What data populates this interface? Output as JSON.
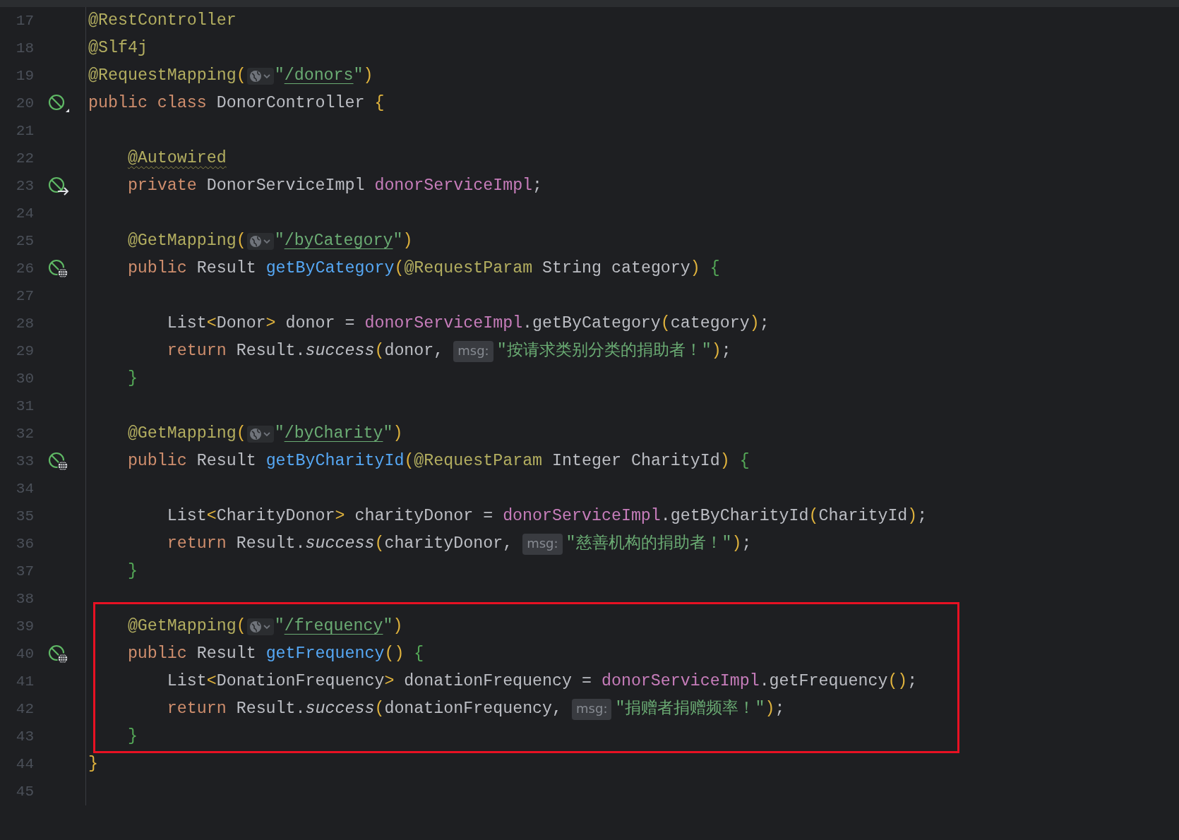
{
  "editor": {
    "lines": [
      {
        "number": "17",
        "highlighted": false,
        "tokens": [
          {
            "kind": "ann",
            "text": "@RestController"
          }
        ]
      },
      {
        "number": "18",
        "highlighted": false,
        "tokens": [
          {
            "kind": "ann",
            "text": "@Slf4j"
          }
        ]
      },
      {
        "number": "19",
        "highlighted": false,
        "tokens": [
          {
            "kind": "ann",
            "text": "@RequestMapping"
          },
          {
            "kind": "paren",
            "text": "("
          },
          {
            "kind": "globe"
          },
          {
            "kind": "str",
            "text": "\""
          },
          {
            "kind": "url",
            "text": "/donors"
          },
          {
            "kind": "str",
            "text": "\""
          },
          {
            "kind": "paren",
            "text": ")"
          }
        ]
      },
      {
        "number": "20",
        "highlighted": false,
        "gutter_icon": {
          "kind": "bean"
        },
        "tokens": [
          {
            "kind": "kw",
            "text": "public class "
          },
          {
            "kind": "plain",
            "text": "DonorController "
          },
          {
            "kind": "paren",
            "text": "{"
          }
        ],
        "children": [
          {
            "number": "21",
            "highlighted": false
          },
          {
            "number": "22",
            "highlighted": false,
            "tokens": [
              {
                "kind": "warn",
                "text": "@Autowired"
              }
            ]
          },
          {
            "number": "23",
            "highlighted": false,
            "gutter_icon": {
              "kind": "autowired"
            },
            "tokens": [
              {
                "kind": "kw",
                "text": "private "
              },
              {
                "kind": "plain",
                "text": "DonorServiceImpl "
              },
              {
                "kind": "field",
                "text": "donorServiceImpl"
              },
              {
                "kind": "plain",
                "text": ";"
              }
            ]
          },
          {
            "number": "24",
            "highlighted": false
          },
          {
            "number": "25",
            "highlighted": false,
            "tokens": [
              {
                "kind": "ann",
                "text": "@GetMapping"
              },
              {
                "kind": "paren",
                "text": "("
              },
              {
                "kind": "globe"
              },
              {
                "kind": "str",
                "text": "\""
              },
              {
                "kind": "url",
                "text": "/byCategory"
              },
              {
                "kind": "str",
                "text": "\""
              },
              {
                "kind": "paren",
                "text": ")"
              }
            ]
          },
          {
            "number": "26",
            "highlighted": false,
            "gutter_icon": {
              "kind": "endpoint"
            },
            "tokens": [
              {
                "kind": "kw",
                "text": "public "
              },
              {
                "kind": "plain",
                "text": "Result "
              },
              {
                "kind": "decl",
                "text": "getByCategory"
              },
              {
                "kind": "paren",
                "text": "("
              },
              {
                "kind": "ann",
                "text": "@RequestParam"
              },
              {
                "kind": "plain",
                "text": " String category"
              },
              {
                "kind": "paren",
                "text": ")"
              },
              {
                "kind": "brace",
                "text": " {"
              }
            ],
            "children": [
              {
                "number": "27",
                "highlighted": false
              },
              {
                "number": "28",
                "highlighted": false,
                "tokens": [
                  {
                    "kind": "plain",
                    "text": "List"
                  },
                  {
                    "kind": "paren",
                    "text": "<"
                  },
                  {
                    "kind": "plain",
                    "text": "Donor"
                  },
                  {
                    "kind": "paren",
                    "text": ">"
                  },
                  {
                    "kind": "plain",
                    "text": " donor = "
                  },
                  {
                    "kind": "field",
                    "text": "donorServiceImpl"
                  },
                  {
                    "kind": "plain",
                    "text": ".getByCategory"
                  },
                  {
                    "kind": "paren",
                    "text": "("
                  },
                  {
                    "kind": "plain",
                    "text": "category"
                  },
                  {
                    "kind": "paren",
                    "text": ")"
                  },
                  {
                    "kind": "plain",
                    "text": ";"
                  }
                ]
              },
              {
                "number": "29",
                "highlighted": false,
                "tokens": [
                  {
                    "kind": "kw",
                    "text": "return "
                  },
                  {
                    "kind": "plain",
                    "text": "Result."
                  },
                  {
                    "kind": "italic",
                    "text": "success"
                  },
                  {
                    "kind": "paren",
                    "text": "("
                  },
                  {
                    "kind": "plain",
                    "text": "donor, "
                  },
                  {
                    "kind": "hint",
                    "text": "msg:"
                  },
                  {
                    "kind": "str",
                    "text": "\"按请求类别分类的捐助者！\""
                  },
                  {
                    "kind": "paren",
                    "text": ")"
                  },
                  {
                    "kind": "plain",
                    "text": ";"
                  }
                ]
              }
            ]
          },
          {
            "number": "30",
            "highlighted": false,
            "tokens": [
              {
                "kind": "brace",
                "text": "}"
              }
            ]
          },
          {
            "number": "31",
            "highlighted": false
          },
          {
            "number": "32",
            "highlighted": false,
            "tokens": [
              {
                "kind": "ann",
                "text": "@GetMapping"
              },
              {
                "kind": "paren",
                "text": "("
              },
              {
                "kind": "globe"
              },
              {
                "kind": "str",
                "text": "\""
              },
              {
                "kind": "url",
                "text": "/byCharity"
              },
              {
                "kind": "str",
                "text": "\""
              },
              {
                "kind": "paren",
                "text": ")"
              }
            ]
          },
          {
            "number": "33",
            "highlighted": false,
            "gutter_icon": {
              "kind": "endpoint"
            },
            "tokens": [
              {
                "kind": "kw",
                "text": "public "
              },
              {
                "kind": "plain",
                "text": "Result "
              },
              {
                "kind": "decl",
                "text": "getByCharityId"
              },
              {
                "kind": "paren",
                "text": "("
              },
              {
                "kind": "ann",
                "text": "@RequestParam"
              },
              {
                "kind": "plain",
                "text": " Integer CharityId"
              },
              {
                "kind": "paren",
                "text": ")"
              },
              {
                "kind": "brace",
                "text": " {"
              }
            ],
            "children": [
              {
                "number": "34",
                "highlighted": false
              },
              {
                "number": "35",
                "highlighted": false,
                "tokens": [
                  {
                    "kind": "plain",
                    "text": "List"
                  },
                  {
                    "kind": "paren",
                    "text": "<"
                  },
                  {
                    "kind": "plain",
                    "text": "CharityDonor"
                  },
                  {
                    "kind": "paren",
                    "text": ">"
                  },
                  {
                    "kind": "plain",
                    "text": " charityDonor = "
                  },
                  {
                    "kind": "field",
                    "text": "donorServiceImpl"
                  },
                  {
                    "kind": "plain",
                    "text": ".getByCharityId"
                  },
                  {
                    "kind": "paren",
                    "text": "("
                  },
                  {
                    "kind": "plain",
                    "text": "CharityId"
                  },
                  {
                    "kind": "paren",
                    "text": ")"
                  },
                  {
                    "kind": "plain",
                    "text": ";"
                  }
                ]
              },
              {
                "number": "36",
                "highlighted": false,
                "tokens": [
                  {
                    "kind": "kw",
                    "text": "return "
                  },
                  {
                    "kind": "plain",
                    "text": "Result."
                  },
                  {
                    "kind": "italic",
                    "text": "success"
                  },
                  {
                    "kind": "paren",
                    "text": "("
                  },
                  {
                    "kind": "plain",
                    "text": "charityDonor, "
                  },
                  {
                    "kind": "hint",
                    "text": "msg:"
                  },
                  {
                    "kind": "str",
                    "text": "\"慈善机构的捐助者！\""
                  },
                  {
                    "kind": "paren",
                    "text": ")"
                  },
                  {
                    "kind": "plain",
                    "text": ";"
                  }
                ]
              }
            ]
          },
          {
            "number": "37",
            "highlighted": false,
            "tokens": [
              {
                "kind": "brace",
                "text": "}"
              }
            ]
          },
          {
            "number": "38",
            "highlighted": false
          },
          {
            "number": "39",
            "highlighted": true,
            "tokens": [
              {
                "kind": "ann",
                "text": "@GetMapping"
              },
              {
                "kind": "paren",
                "text": "("
              },
              {
                "kind": "globe"
              },
              {
                "kind": "str",
                "text": "\""
              },
              {
                "kind": "url",
                "text": "/frequency"
              },
              {
                "kind": "str",
                "text": "\""
              },
              {
                "kind": "paren",
                "text": ")"
              }
            ]
          },
          {
            "number": "40",
            "highlighted": true,
            "gutter_icon": {
              "kind": "endpoint"
            },
            "tokens": [
              {
                "kind": "kw",
                "text": "public "
              },
              {
                "kind": "plain",
                "text": "Result "
              },
              {
                "kind": "decl",
                "text": "getFrequency"
              },
              {
                "kind": "paren",
                "text": "()"
              },
              {
                "kind": "brace",
                "text": " {"
              }
            ],
            "children": [
              {
                "number": "41",
                "highlighted": true,
                "tokens": [
                  {
                    "kind": "plain",
                    "text": "List"
                  },
                  {
                    "kind": "paren",
                    "text": "<"
                  },
                  {
                    "kind": "plain",
                    "text": "DonationFrequency"
                  },
                  {
                    "kind": "paren",
                    "text": ">"
                  },
                  {
                    "kind": "plain",
                    "text": " donationFrequency = "
                  },
                  {
                    "kind": "field",
                    "text": "donorServiceImpl"
                  },
                  {
                    "kind": "plain",
                    "text": ".getFrequency"
                  },
                  {
                    "kind": "paren",
                    "text": "()"
                  },
                  {
                    "kind": "plain",
                    "text": ";"
                  }
                ]
              },
              {
                "number": "42",
                "highlighted": true,
                "tokens": [
                  {
                    "kind": "kw",
                    "text": "return "
                  },
                  {
                    "kind": "plain",
                    "text": "Result."
                  },
                  {
                    "kind": "italic",
                    "text": "success"
                  },
                  {
                    "kind": "paren",
                    "text": "("
                  },
                  {
                    "kind": "plain",
                    "text": "donationFrequency, "
                  },
                  {
                    "kind": "hint",
                    "text": "msg:"
                  },
                  {
                    "kind": "str",
                    "text": "\"捐赠者捐赠频率！\""
                  },
                  {
                    "kind": "paren",
                    "text": ")"
                  },
                  {
                    "kind": "plain",
                    "text": ";"
                  }
                ]
              }
            ]
          },
          {
            "number": "43",
            "highlighted": true,
            "tokens": [
              {
                "kind": "brace",
                "text": "}"
              }
            ]
          }
        ]
      },
      {
        "number": "44",
        "highlighted": false,
        "tokens": [
          {
            "kind": "paren",
            "text": "}"
          }
        ]
      },
      {
        "number": "45",
        "highlighted": false
      }
    ]
  }
}
